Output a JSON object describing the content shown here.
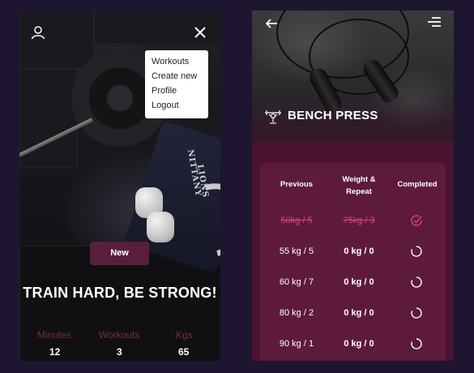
{
  "left_screen": {
    "menu": {
      "items": [
        "Workouts",
        "Create new",
        "Profile",
        "Logout"
      ]
    },
    "new_button": "New",
    "headline": "TRAIN HARD, BE STRONG!",
    "stats": [
      {
        "label": "Minutes",
        "value": "12"
      },
      {
        "label": "Workouts",
        "value": "3"
      },
      {
        "label": "Kgs",
        "value": "65"
      }
    ],
    "icons": {
      "profile": "user-icon",
      "close": "close-icon"
    },
    "photo_text": {
      "line1": "NITTANY",
      "line2": "LIONS"
    }
  },
  "right_screen": {
    "title": "BENCH PRESS",
    "icons": {
      "back": "arrow-left-icon",
      "menu": "hamburger-icon",
      "title": "bench-press-icon",
      "check": "check-circle-icon",
      "spinner": "loading-circle-icon"
    },
    "table": {
      "headers": {
        "previous": "Previous",
        "weight_repeat": "Weight &\nRepeat",
        "completed": "Completed"
      },
      "rows": [
        {
          "previous": "50kg / 5",
          "weight_repeat": "75kg / 3",
          "status": "done"
        },
        {
          "previous": "55 kg / 5",
          "weight_repeat": "0 kg / 0",
          "status": "pending"
        },
        {
          "previous": "60 kg / 7",
          "weight_repeat": "0 kg / 0",
          "status": "pending"
        },
        {
          "previous": "80 kg / 2",
          "weight_repeat": "0 kg / 0",
          "status": "pending"
        },
        {
          "previous": "90 kg / 1",
          "weight_repeat": "0 kg / 0",
          "status": "pending"
        }
      ]
    }
  },
  "colors": {
    "background": "#1e1530",
    "accent": "#5a1e3c",
    "card": "#5d1a3d",
    "highlight": "#d4497a"
  }
}
